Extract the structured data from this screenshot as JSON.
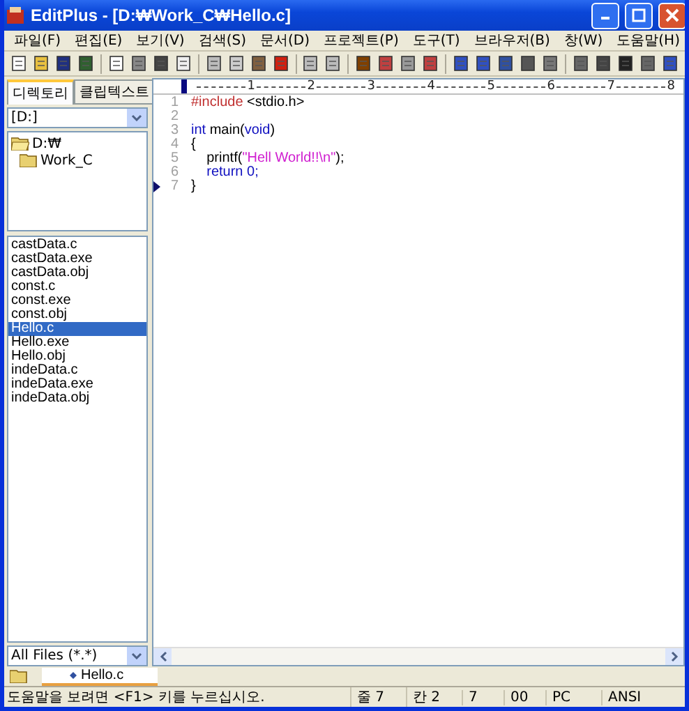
{
  "window": {
    "title": "EditPlus - [D:₩Work_C₩Hello.c]"
  },
  "menu": [
    "파일(F)",
    "편집(E)",
    "보기(V)",
    "검색(S)",
    "문서(D)",
    "프로젝트(P)",
    "도구(T)",
    "브라우저(B)",
    "창(W)",
    "도움말(H)"
  ],
  "sidebar": {
    "tabs": [
      {
        "label": "디렉토리",
        "selected": true
      },
      {
        "label": "클립텍스트",
        "selected": false
      }
    ],
    "drive": "[D:]",
    "tree": [
      {
        "label": "D:₩",
        "children": [
          {
            "label": "Work_C"
          }
        ]
      }
    ],
    "files": [
      {
        "name": "castData.c",
        "selected": false
      },
      {
        "name": "castData.exe",
        "selected": false
      },
      {
        "name": "castData.obj",
        "selected": false
      },
      {
        "name": "const.c",
        "selected": false
      },
      {
        "name": "const.exe",
        "selected": false
      },
      {
        "name": "const.obj",
        "selected": false
      },
      {
        "name": "Hello.c",
        "selected": true
      },
      {
        "name": "Hello.exe",
        "selected": false
      },
      {
        "name": "Hello.obj",
        "selected": false
      },
      {
        "name": "indeData.c",
        "selected": false
      },
      {
        "name": "indeData.exe",
        "selected": false
      },
      {
        "name": "indeData.obj",
        "selected": false
      }
    ],
    "filter": "All Files (*.*)"
  },
  "ruler": [
    "1",
    "2",
    "3",
    "4",
    "5",
    "6",
    "7",
    "8"
  ],
  "code": [
    {
      "number": "1",
      "current": false,
      "tokens": [
        {
          "text": "#include",
          "kind": "preproc"
        },
        {
          "text": " <stdio.h>",
          "kind": "plain"
        }
      ]
    },
    {
      "number": "2",
      "current": false
    },
    {
      "number": "3",
      "current": false,
      "tokens": [
        {
          "text": "int",
          "kind": "keyword"
        },
        {
          "text": " main(",
          "kind": "plain"
        },
        {
          "text": "void",
          "kind": "keyword"
        },
        {
          "text": ")",
          "kind": "plain"
        }
      ]
    },
    {
      "number": "4",
      "current": false,
      "tokens": [
        {
          "text": "{",
          "kind": "plain"
        }
      ]
    },
    {
      "number": "5",
      "current": false,
      "tokens": [
        {
          "text": "    printf(",
          "kind": "plain"
        },
        {
          "text": "\"Hell World!!\\n\"",
          "kind": "string"
        },
        {
          "text": ");",
          "kind": "plain"
        }
      ]
    },
    {
      "number": "6",
      "current": false,
      "tokens": [
        {
          "text": "    return",
          "kind": "keyword"
        },
        {
          "text": " 0;",
          "kind": "number"
        }
      ]
    },
    {
      "number": "7",
      "current": true,
      "tokens": [
        {
          "text": "}",
          "kind": "plain"
        }
      ]
    }
  ],
  "doc_tabs": [
    {
      "label": "Hello.c",
      "selected": true
    }
  ],
  "status_bar": {
    "message": "도움말을 보려면 <F1> 키를 누르십시오.",
    "fields": [
      "줄 7",
      "칸 2",
      "7",
      "00",
      "PC",
      "ANSI"
    ]
  }
}
